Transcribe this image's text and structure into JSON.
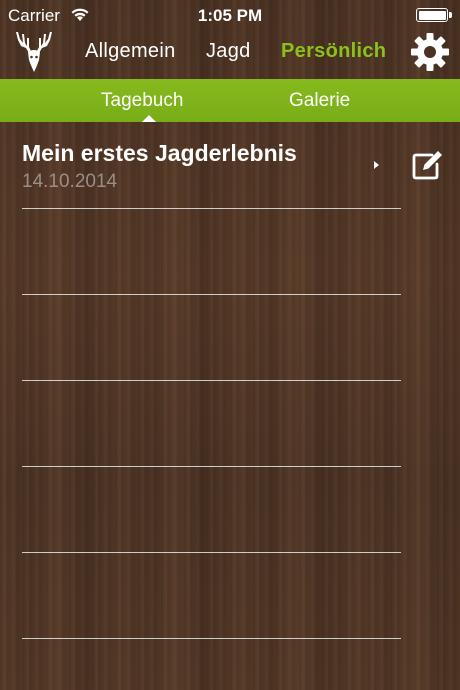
{
  "status_bar": {
    "carrier": "Carrier",
    "time": "1:05 PM",
    "wifi_icon": "wifi-icon",
    "battery_icon": "battery-icon"
  },
  "top_nav": {
    "logo_icon": "deer-antlers-logo-icon",
    "items": [
      {
        "label": "Allgemein",
        "active": false
      },
      {
        "label": "Jagd",
        "active": false
      },
      {
        "label": "Persönlich",
        "active": true
      }
    ],
    "settings_icon": "gear-icon",
    "active_color": "#8bc21a"
  },
  "sub_nav": {
    "background_color": "#7fb31a",
    "tabs": [
      {
        "label": "Tagebuch",
        "active": true
      },
      {
        "label": "Galerie",
        "active": false
      }
    ]
  },
  "diary": {
    "entries": [
      {
        "title": "Mein erstes Jagderlebnis",
        "date": "14.10.2014"
      }
    ],
    "chevron_icon": "chevron-right-icon",
    "edit_icon": "edit-icon",
    "date_color": "#9a8e86"
  }
}
